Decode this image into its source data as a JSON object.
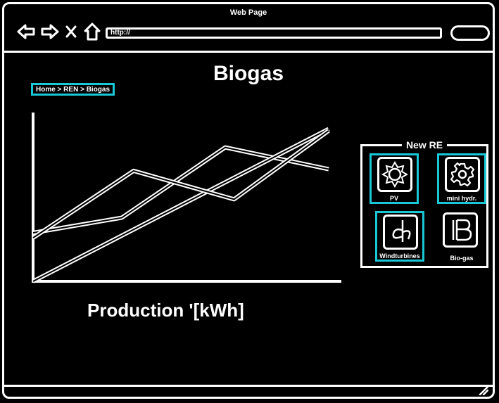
{
  "window": {
    "title": "Web Page"
  },
  "toolbar": {
    "url": "http://"
  },
  "page": {
    "title": "Biogas",
    "breadcrumb": "Home > REN > Biogas"
  },
  "chart_data": {
    "type": "line",
    "title": "Production '[kWh]",
    "xlim": [
      0,
      100
    ],
    "ylim": [
      0,
      100
    ],
    "series": [
      {
        "x": [
          0,
          30,
          65,
          100
        ],
        "y": [
          29,
          38,
          80,
          67
        ]
      },
      {
        "x": [
          0,
          100
        ],
        "y": [
          0,
          91
        ]
      },
      {
        "x": [
          0,
          34,
          68,
          100
        ],
        "y": [
          26,
          66,
          49,
          90
        ]
      }
    ]
  },
  "re_panel": {
    "title": "New RE",
    "tiles": [
      {
        "label": "PV",
        "icon": "sun-icon",
        "selected": true
      },
      {
        "label": "mini hydr.",
        "icon": "gear-icon",
        "selected": true
      },
      {
        "label": "Windturbines",
        "icon": "windturbine-icon",
        "selected": true
      },
      {
        "label": "Bio-gas",
        "icon": "biogas-icon",
        "selected": false
      }
    ]
  }
}
